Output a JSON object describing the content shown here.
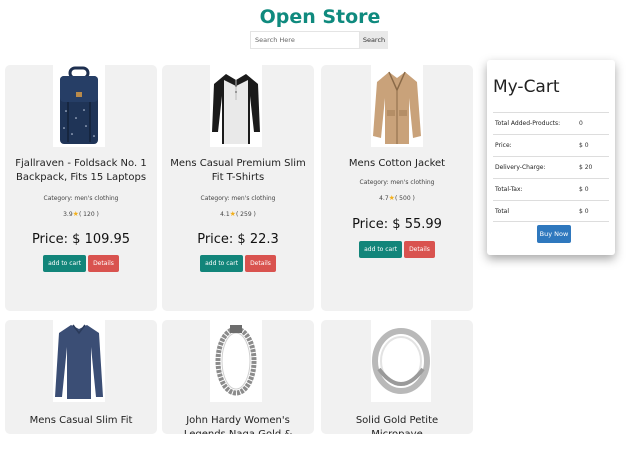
{
  "header": {
    "title": "Open Store",
    "search_placeholder": "Search Here",
    "search_button": "Search"
  },
  "products": [
    {
      "name": "Fjallraven - Foldsack No. 1 Backpack, Fits 15 Laptops",
      "category": "Category: men's clothing",
      "rating": "3.9",
      "count": "( 120 )",
      "price": "Price: $ 109.95",
      "image": "backpack-icon"
    },
    {
      "name": "Mens Casual Premium Slim Fit T-Shirts",
      "category": "Category: men's clothing",
      "rating": "4.1",
      "count": "( 259 )",
      "price": "Price: $ 22.3",
      "image": "tshirt-icon"
    },
    {
      "name": "Mens Cotton Jacket",
      "category": "Category: men's clothing",
      "rating": "4.7",
      "count": "( 500 )",
      "price": "Price: $ 55.99",
      "image": "jacket-icon"
    },
    {
      "name": "Mens Casual Slim Fit",
      "image": "longsleeve-icon"
    },
    {
      "name": "John Hardy Women's Legends Naga Gold & Silver Dragon Station",
      "image": "bracelet-icon"
    },
    {
      "name": "Solid Gold Petite Micropave",
      "image": "ring-icon"
    }
  ],
  "buttons": {
    "add_to_cart": "add to cart",
    "details": "Details"
  },
  "cart": {
    "title": "My-Cart",
    "rows": [
      {
        "label": "Total Added-Products:",
        "value": "0"
      },
      {
        "label": "Price:",
        "value": "$ 0"
      },
      {
        "label": "Delivery-Charge:",
        "value": "$ 20"
      },
      {
        "label": "Total-Tax:",
        "value": "$ 0"
      },
      {
        "label": "Total",
        "value": "$ 0"
      }
    ],
    "buy_button": "Buy Now"
  },
  "colors": {
    "brand": "#0f8a7e",
    "add_button": "#12857a",
    "details_button": "#d9534f",
    "buy_button": "#2f78be",
    "card_bg": "#f1f1f1",
    "star": "#f2b01e"
  }
}
